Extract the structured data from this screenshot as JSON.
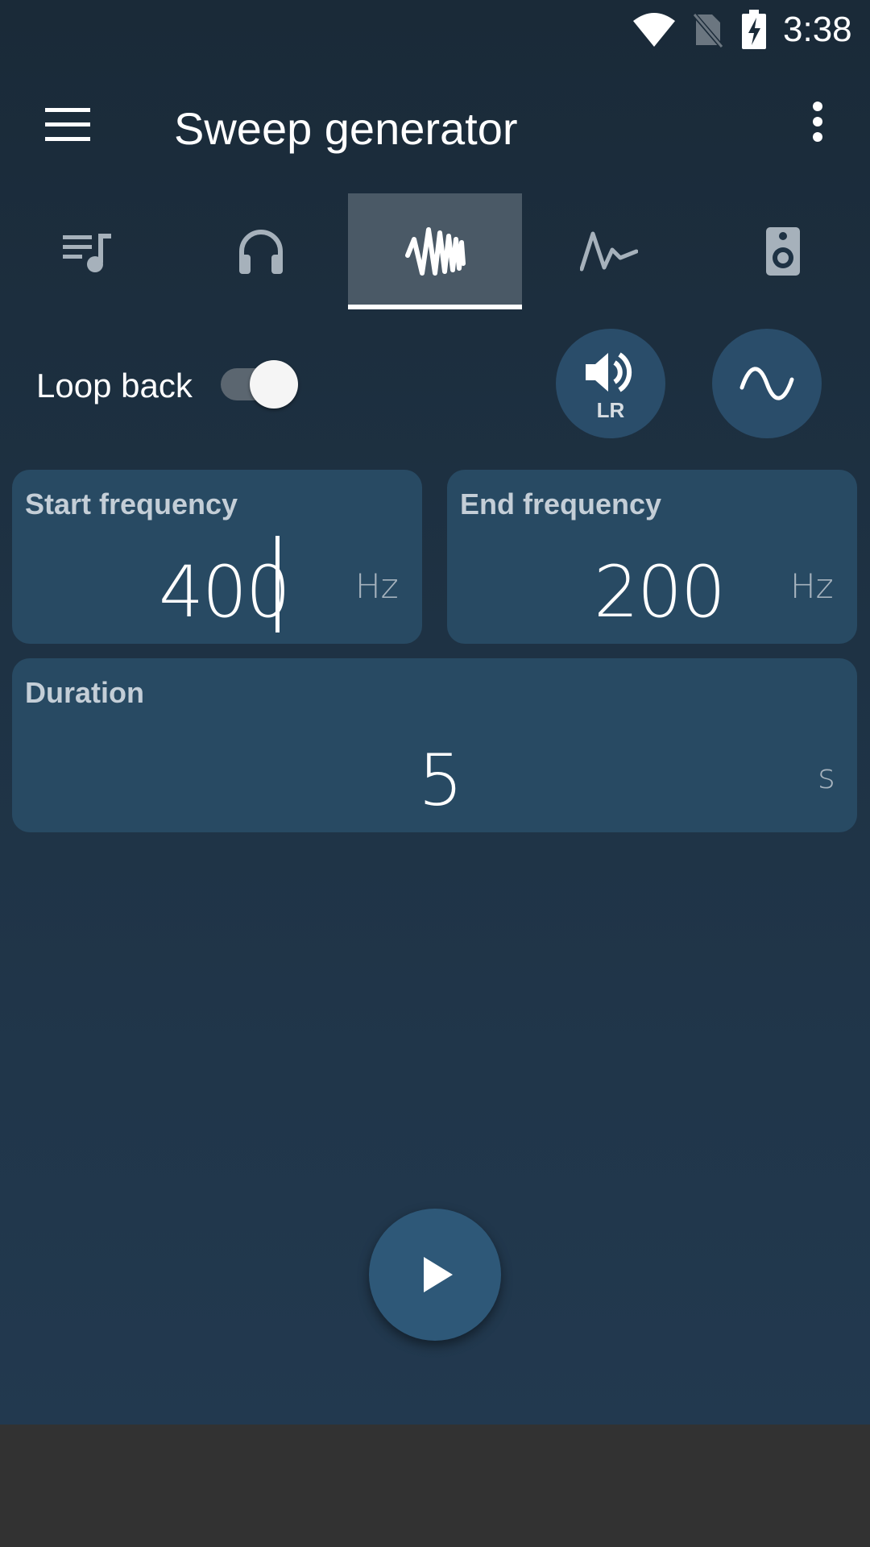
{
  "status_bar": {
    "time": "3:38",
    "icons": [
      "wifi-icon",
      "no-sim-icon",
      "battery-charging-icon"
    ]
  },
  "toolbar": {
    "title": "Sweep generator",
    "menu_icon": "hamburger-menu-icon",
    "more_icon": "more-vert-icon"
  },
  "tabs": [
    {
      "icon": "playlist-music-icon",
      "active": false
    },
    {
      "icon": "headphones-icon",
      "active": false
    },
    {
      "icon": "sweep-wave-icon",
      "active": true
    },
    {
      "icon": "pulse-wave-icon",
      "active": false
    },
    {
      "icon": "speaker-icon",
      "active": false
    }
  ],
  "loop_back": {
    "label": "Loop back",
    "enabled": true
  },
  "channel_button": {
    "icon": "volume-icon",
    "label": "LR"
  },
  "waveform_button": {
    "icon": "sine-wave-icon"
  },
  "start_frequency": {
    "label": "Start frequency",
    "value": "400",
    "unit": "Hz"
  },
  "end_frequency": {
    "label": "End frequency",
    "value": "200",
    "unit": "Hz"
  },
  "duration": {
    "label": "Duration",
    "value": "5",
    "unit": "s"
  },
  "play_button": {
    "icon": "play-icon"
  },
  "colors": {
    "background_top": "#1a2a38",
    "card": "#284a63",
    "round_button": "#2a4d6a",
    "active_tab": "#4a5966",
    "nav_bar": "#323232"
  }
}
